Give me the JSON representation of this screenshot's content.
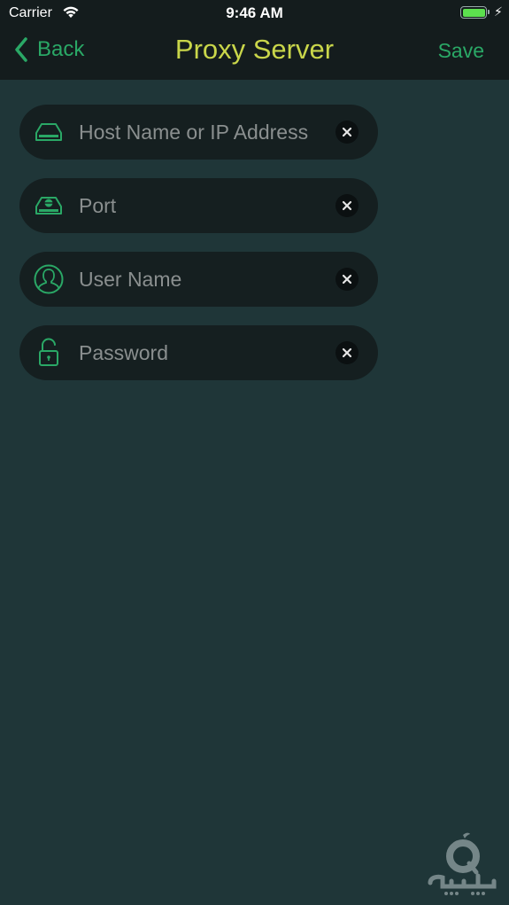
{
  "status_bar": {
    "carrier": "Carrier",
    "time": "9:46 AM",
    "battery_level": 1.0,
    "charging": true
  },
  "nav": {
    "back_label": "Back",
    "title": "Proxy Server",
    "save_label": "Save"
  },
  "form": {
    "fields": [
      {
        "id": "host",
        "placeholder": "Host Name or IP Address",
        "value": "",
        "icon": "drive-icon"
      },
      {
        "id": "port",
        "placeholder": "Port",
        "value": "",
        "icon": "drive-port-icon"
      },
      {
        "id": "username",
        "placeholder": "User Name",
        "value": "",
        "icon": "user-icon"
      },
      {
        "id": "password",
        "placeholder": "Password",
        "value": "",
        "icon": "unlock-icon"
      }
    ]
  },
  "colors": {
    "background": "#1f3638",
    "topbar": "#141c1d",
    "accent_green": "#2aa866",
    "title_yellow": "#c9d64a",
    "field_bg": "#151f20",
    "placeholder": "#8a8f8f"
  }
}
